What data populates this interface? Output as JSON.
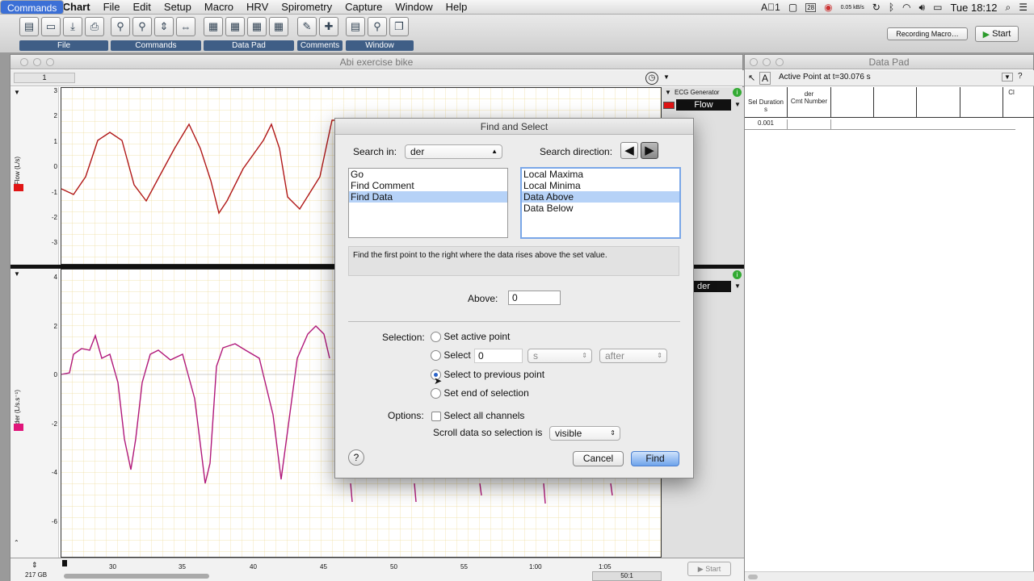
{
  "menubar": {
    "app": "LabChart",
    "items": [
      "File",
      "Edit",
      "Setup",
      "Commands",
      "Macro",
      "HRV",
      "Spirometry",
      "Capture",
      "Window",
      "Help"
    ],
    "selected": "Commands",
    "net_speed": "0.05 kB/s",
    "clock": "Tue 18:12",
    "calendar_day": "28"
  },
  "toolbar": {
    "groups": [
      "File",
      "Commands",
      "Data Pad",
      "Comments",
      "Window"
    ],
    "recording_macro": "Recording Macro…",
    "start": "Start"
  },
  "main_window": {
    "title": "Abi exercise bike",
    "channel_number": "1",
    "top_channel": {
      "name": "Flow",
      "ylabel": "Flow (L/s)",
      "generator": "ECG Generator",
      "ticks": [
        "3",
        "2",
        "1",
        "0",
        "-1",
        "-2",
        "-3"
      ]
    },
    "bottom_channel": {
      "name": "der",
      "ylabel": "der (L/s.s⁻¹)",
      "ticks": [
        "4",
        "2",
        "0",
        "-2",
        "-4",
        "-6"
      ]
    },
    "x_ticks": [
      "30",
      "35",
      "40",
      "45",
      "50",
      "55",
      "1:00",
      "1:05"
    ],
    "disk": "217 GB",
    "zoom": "50:1",
    "start": "Start",
    "colors": {
      "flow": "#b01818",
      "der": "#b0187a",
      "grid": "#e8d88a"
    }
  },
  "data_pad": {
    "title": "Data Pad",
    "active_point": "Active Point at t=30.076 s",
    "col1_header": "Sel Duration",
    "col1_unit": "s",
    "col2_header": "der",
    "col2_sub": "Cmt Number",
    "col1_value": "0.001",
    "col_c": "Cl"
  },
  "dialog": {
    "title": "Find and Select",
    "search_in_label": "Search in:",
    "search_in_value": "der",
    "search_direction_label": "Search direction:",
    "left_list": [
      "Go",
      "Find Comment",
      "Find Data"
    ],
    "left_selected": "Find Data",
    "right_list": [
      "Local Maxima",
      "Local Minima",
      "Data Above",
      "Data Below"
    ],
    "right_selected": "Data Above",
    "description": "Find the first point to the right where the data rises above the set value.",
    "above_label": "Above:",
    "above_value": "0",
    "selection_label": "Selection:",
    "radio_set_active": "Set active point",
    "radio_select": "Select",
    "select_value": "0",
    "select_unit": "s",
    "select_when": "after",
    "radio_prev": "Select to previous point",
    "radio_end": "Set end of selection",
    "options_label": "Options:",
    "select_all_channels": "Select all channels",
    "scroll_label": "Scroll data so selection is",
    "scroll_value": "visible",
    "help": "?",
    "cancel": "Cancel",
    "find": "Find"
  }
}
